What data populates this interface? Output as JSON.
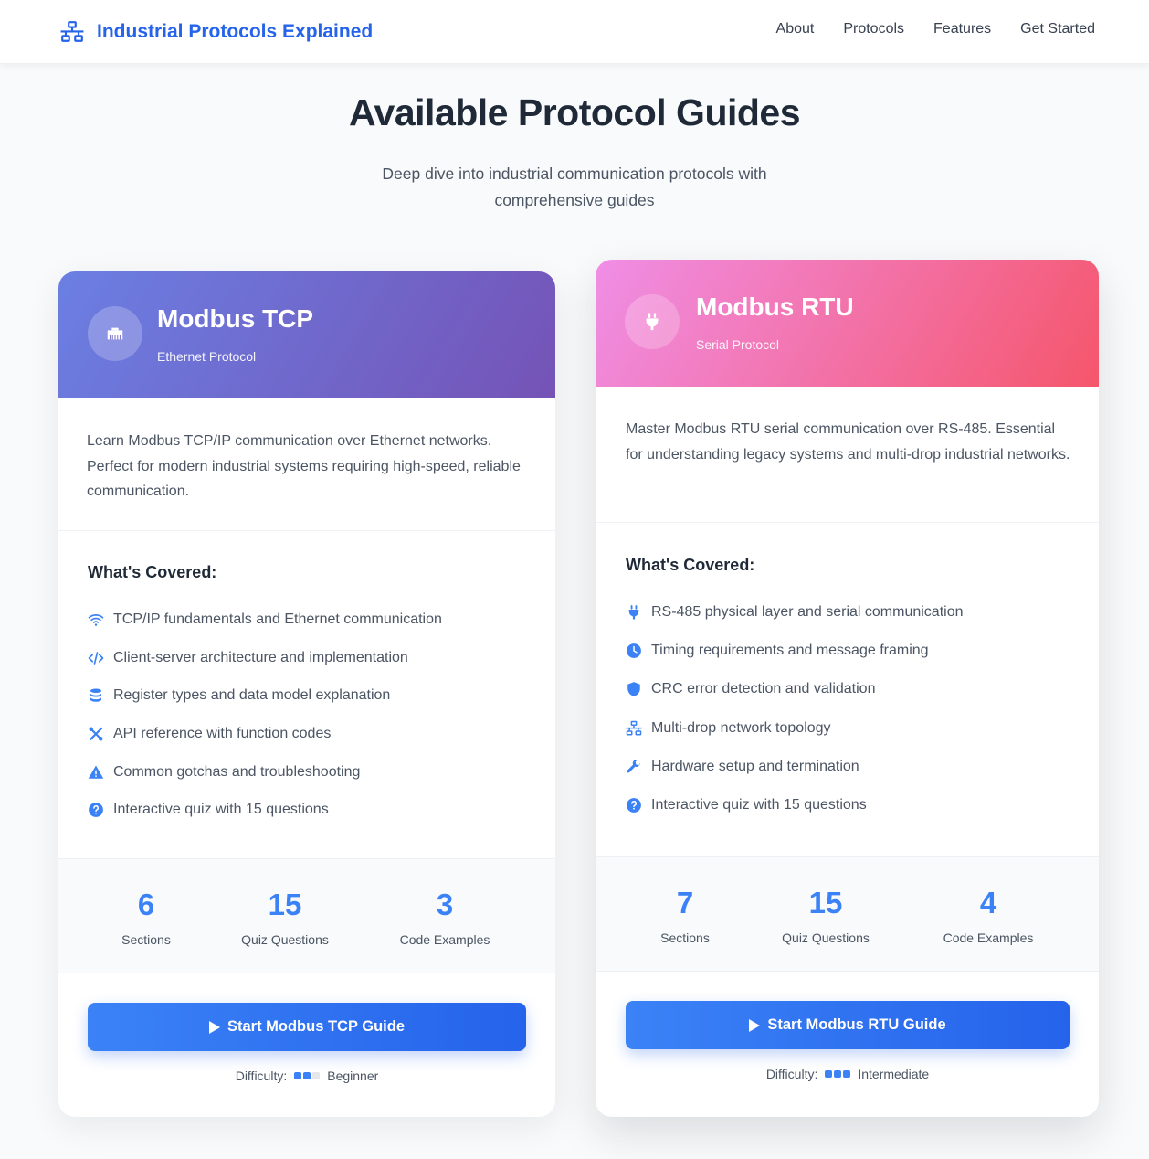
{
  "header": {
    "brand": "Industrial Protocols Explained",
    "brand_icon": "network-icon",
    "nav": [
      "About",
      "Protocols",
      "Features",
      "Get Started"
    ]
  },
  "section": {
    "title": "Available Protocol Guides",
    "subtitle": "Deep dive into industrial communication protocols with comprehensive guides"
  },
  "colors": {
    "brand": "#2563eb",
    "accent": "#3b82f6",
    "tcp_gradient": [
      "#6b7fe3",
      "#7553b6"
    ],
    "rtu_gradient": [
      "#f08ee6",
      "#f5566b"
    ]
  },
  "cards": [
    {
      "id": "tcp",
      "icon": "ethernet-icon",
      "title": "Modbus TCP",
      "subtitle": "Ethernet Protocol",
      "description": "Learn Modbus TCP/IP communication over Ethernet networks. Perfect for modern industrial systems requiring high-speed, reliable communication.",
      "covered_title": "What's Covered:",
      "features": [
        {
          "icon": "wifi-icon",
          "text": "TCP/IP fundamentals and Ethernet communication"
        },
        {
          "icon": "code-icon",
          "text": "Client-server architecture and implementation"
        },
        {
          "icon": "database-icon",
          "text": "Register types and data model explanation"
        },
        {
          "icon": "tools-icon",
          "text": "API reference with function codes"
        },
        {
          "icon": "warning-icon",
          "text": "Common gotchas and troubleshooting"
        },
        {
          "icon": "question-icon",
          "text": "Interactive quiz with 15 questions"
        }
      ],
      "stats": [
        {
          "value": "6",
          "label": "Sections"
        },
        {
          "value": "15",
          "label": "Quiz Questions"
        },
        {
          "value": "3",
          "label": "Code Examples"
        }
      ],
      "cta": "Start Modbus TCP Guide",
      "difficulty_label": "Difficulty:",
      "difficulty_level": 2,
      "difficulty_max": 3,
      "difficulty_text": "Beginner"
    },
    {
      "id": "rtu",
      "icon": "plug-icon",
      "title": "Modbus RTU",
      "subtitle": "Serial Protocol",
      "description": "Master Modbus RTU serial communication over RS-485. Essential for understanding legacy systems and multi-drop industrial networks.",
      "covered_title": "What's Covered:",
      "features": [
        {
          "icon": "plug-icon",
          "text": "RS-485 physical layer and serial communication"
        },
        {
          "icon": "clock-icon",
          "text": "Timing requirements and message framing"
        },
        {
          "icon": "shield-icon",
          "text": "CRC error detection and validation"
        },
        {
          "icon": "network-icon",
          "text": "Multi-drop network topology"
        },
        {
          "icon": "wrench-icon",
          "text": "Hardware setup and termination"
        },
        {
          "icon": "question-icon",
          "text": "Interactive quiz with 15 questions"
        }
      ],
      "stats": [
        {
          "value": "7",
          "label": "Sections"
        },
        {
          "value": "15",
          "label": "Quiz Questions"
        },
        {
          "value": "4",
          "label": "Code Examples"
        }
      ],
      "cta": "Start Modbus RTU Guide",
      "difficulty_label": "Difficulty:",
      "difficulty_level": 3,
      "difficulty_max": 3,
      "difficulty_text": "Intermediate"
    }
  ]
}
